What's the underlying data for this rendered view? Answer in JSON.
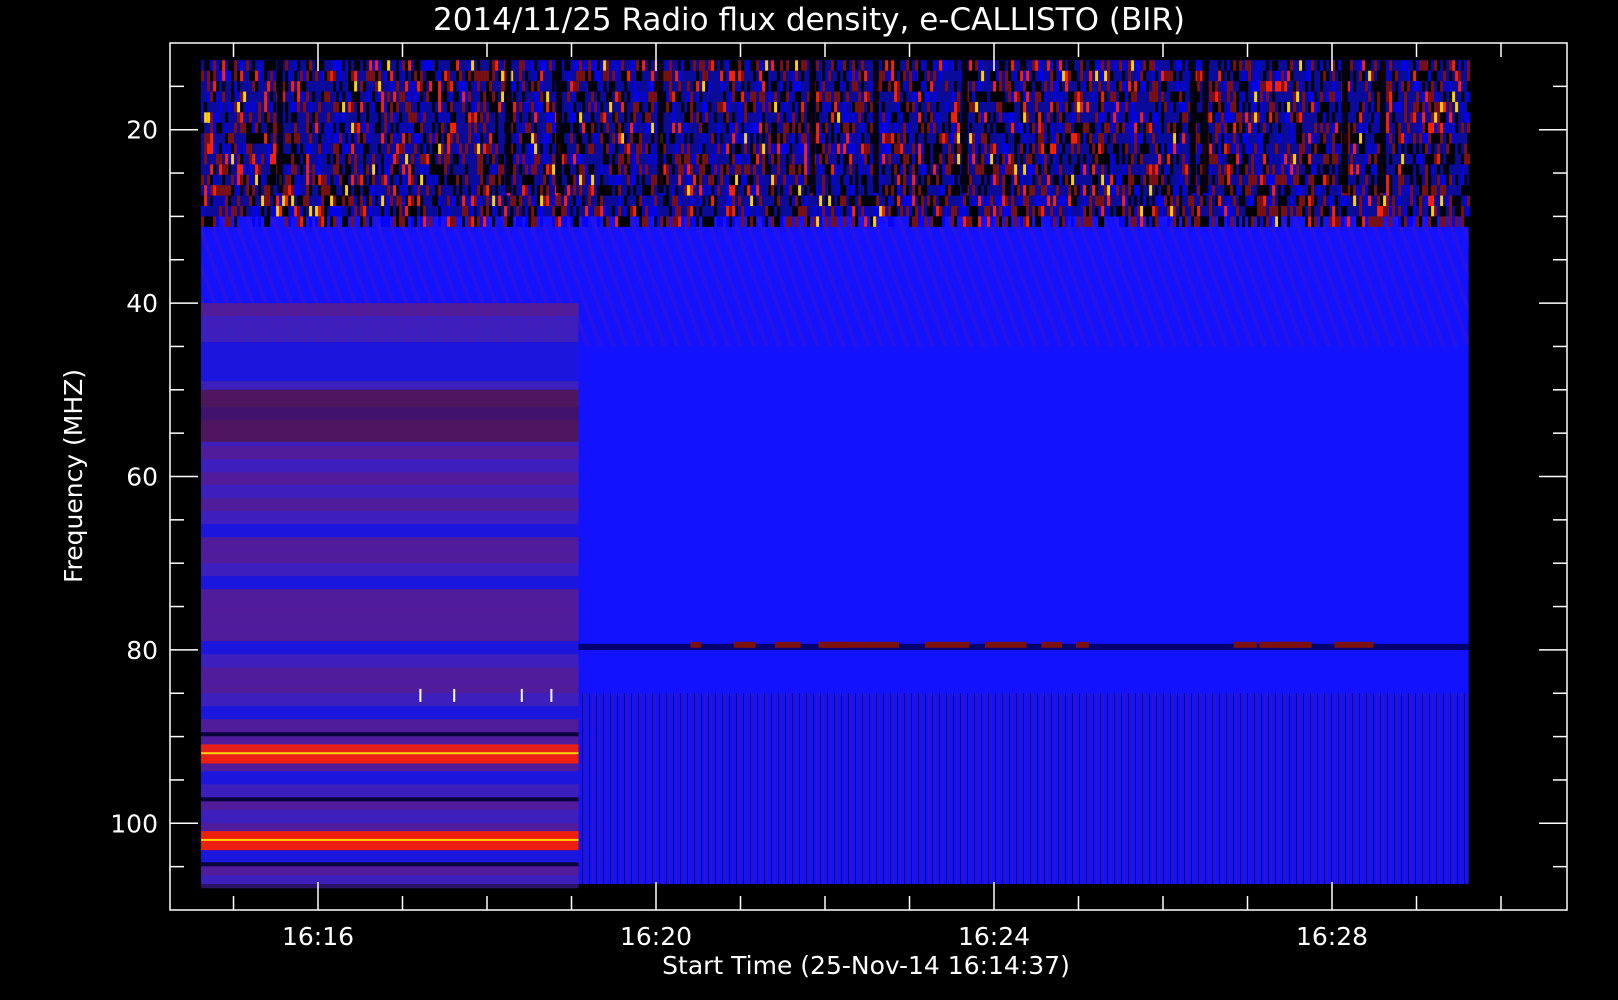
{
  "chart_data": {
    "type": "heatmap",
    "title": "2014/11/25  Radio flux density, e-CALLISTO (BIR)",
    "xlabel": "Start Time (25-Nov-14 16:14:37)",
    "ylabel": "Frequency (MHZ)",
    "x_axis": {
      "unit": "time",
      "start": "16:14:37",
      "end": "16:29:37",
      "tick_labels": [
        "16:16",
        "16:20",
        "16:24",
        "16:28"
      ],
      "tick_minutes": [
        16,
        20,
        24,
        28
      ],
      "minor_tick_minutes": [
        15,
        16,
        17,
        18,
        19,
        20,
        21,
        22,
        23,
        24,
        25,
        26,
        27,
        28,
        29,
        30
      ]
    },
    "y_axis": {
      "unit": "MHz",
      "inverted": true,
      "range": [
        10,
        110
      ],
      "data_range": [
        12,
        107
      ],
      "ticks": [
        20,
        40,
        60,
        80,
        100
      ],
      "minor_ticks": [
        15,
        20,
        25,
        30,
        35,
        40,
        45,
        50,
        55,
        60,
        65,
        70,
        75,
        80,
        85,
        90,
        95,
        100,
        105
      ]
    },
    "colormap": [
      "#000000",
      "#0000ff",
      "#7a1010",
      "#ff2000",
      "#ffd000",
      "#ffffff"
    ],
    "background_color": "#1212ff",
    "grid": false,
    "features": [
      {
        "name": "high-frequency RFI (noisy band)",
        "freq_range": [
          12,
          30
        ],
        "time_range": [
          "16:14:37",
          "16:29:37"
        ]
      },
      {
        "name": "pre-16:19 background change",
        "freq_range": [
          40,
          107
        ],
        "time_range": [
          "16:14:37",
          "16:19:05"
        ]
      },
      {
        "name": "strong band",
        "freq_range": [
          91.5,
          92.5
        ],
        "time_range": [
          "16:14:37",
          "16:19:05"
        ]
      },
      {
        "name": "strong band",
        "freq_range": [
          101.5,
          102.5
        ],
        "time_range": [
          "16:14:37",
          "16:19:05"
        ]
      },
      {
        "name": "persistent line",
        "freq_range": [
          79.3,
          80.0
        ],
        "time_range": [
          "16:19:05",
          "16:29:37"
        ]
      }
    ]
  }
}
